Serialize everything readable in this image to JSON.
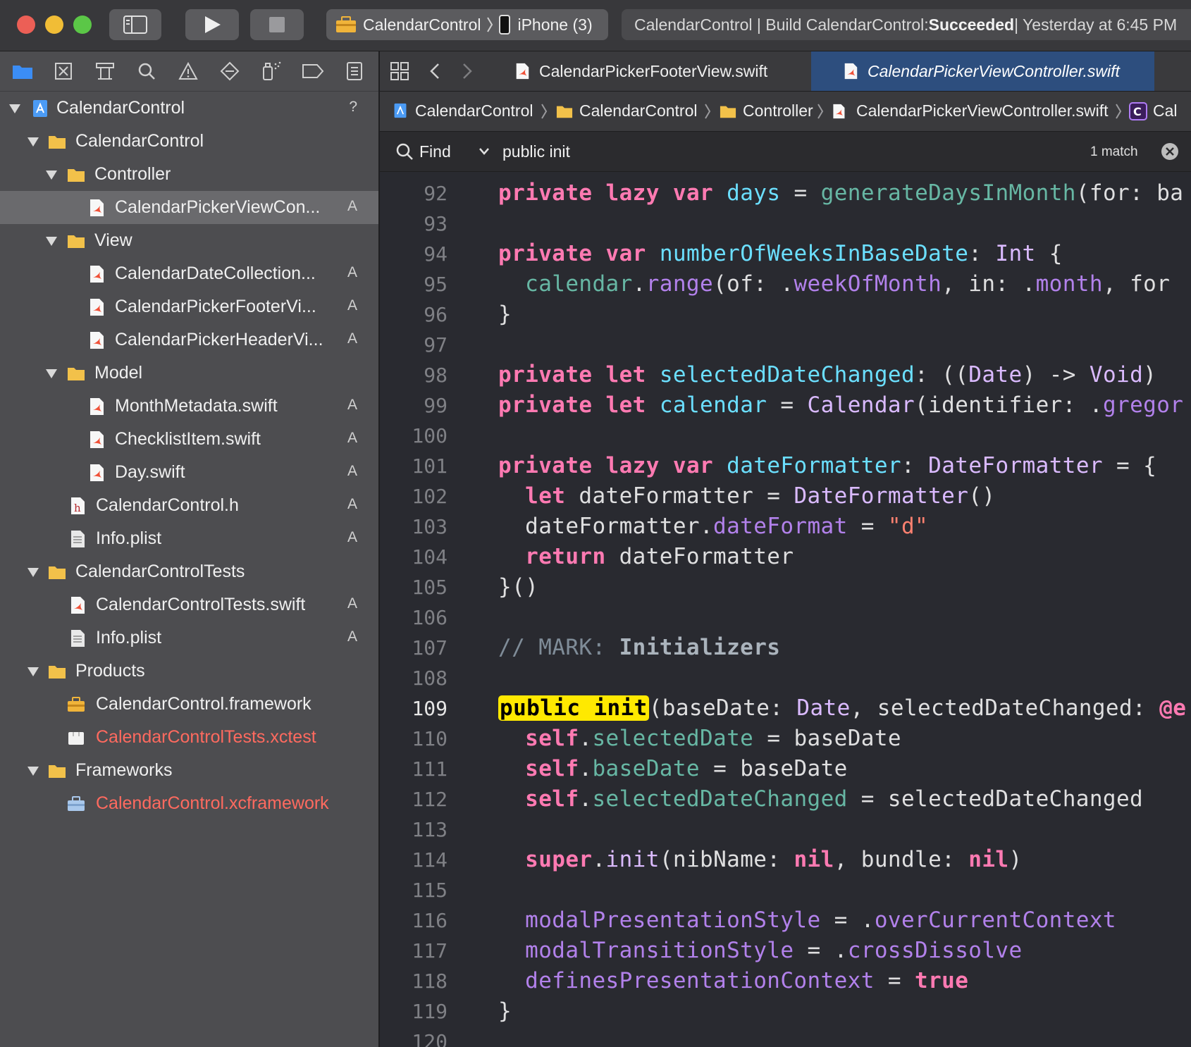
{
  "toolbar": {
    "scheme": "CalendarControl",
    "device": "iPhone (3)",
    "status_prefix": "CalendarControl | Build CalendarControl: ",
    "status_result": "Succeeded",
    "status_suffix": " | Yesterday at 6:45 PM"
  },
  "navigator": {
    "rows": [
      {
        "label": "CalendarControl",
        "badge": "?"
      },
      {
        "label": "CalendarControl",
        "badge": ""
      },
      {
        "label": "Controller",
        "badge": ""
      },
      {
        "label": "CalendarPickerViewCon...",
        "badge": "A"
      },
      {
        "label": "View",
        "badge": ""
      },
      {
        "label": "CalendarDateCollection...",
        "badge": "A"
      },
      {
        "label": "CalendarPickerFooterVi...",
        "badge": "A"
      },
      {
        "label": "CalendarPickerHeaderVi...",
        "badge": "A"
      },
      {
        "label": "Model",
        "badge": ""
      },
      {
        "label": "MonthMetadata.swift",
        "badge": "A"
      },
      {
        "label": "ChecklistItem.swift",
        "badge": "A"
      },
      {
        "label": "Day.swift",
        "badge": "A"
      },
      {
        "label": "CalendarControl.h",
        "badge": "A"
      },
      {
        "label": "Info.plist",
        "badge": "A"
      },
      {
        "label": "CalendarControlTests",
        "badge": ""
      },
      {
        "label": "CalendarControlTests.swift",
        "badge": "A"
      },
      {
        "label": "Info.plist",
        "badge": "A"
      },
      {
        "label": "Products",
        "badge": ""
      },
      {
        "label": "CalendarControl.framework",
        "badge": ""
      },
      {
        "label": "CalendarControlTests.xctest",
        "badge": ""
      },
      {
        "label": "Frameworks",
        "badge": ""
      },
      {
        "label": "CalendarControl.xcframework",
        "badge": ""
      }
    ]
  },
  "editor": {
    "tabs": [
      {
        "label": "CalendarPickerFooterView.swift"
      },
      {
        "label": "CalendarPickerViewController.swift"
      }
    ],
    "breadcrumbs": [
      "CalendarControl",
      "CalendarControl",
      "Controller",
      "CalendarPickerViewController.swift",
      "Cal"
    ],
    "find": {
      "mode": "Find",
      "query": "public init",
      "matches": "1 match"
    },
    "line_numbers": [
      "92",
      "93",
      "94",
      "95",
      "96",
      "97",
      "98",
      "99",
      "100",
      "101",
      "102",
      "103",
      "104",
      "105",
      "106",
      "107",
      "108",
      "109",
      "110",
      "111",
      "112",
      "113",
      "114",
      "115",
      "116",
      "117",
      "118",
      "119",
      "120"
    ]
  },
  "colors": {
    "keyword": "#ff7ab2",
    "type": "#dabaff",
    "declaration": "#6bdfff",
    "function": "#67b7a4",
    "property": "#b281eb",
    "string": "#ff8170",
    "highlight": "#ffe900"
  }
}
